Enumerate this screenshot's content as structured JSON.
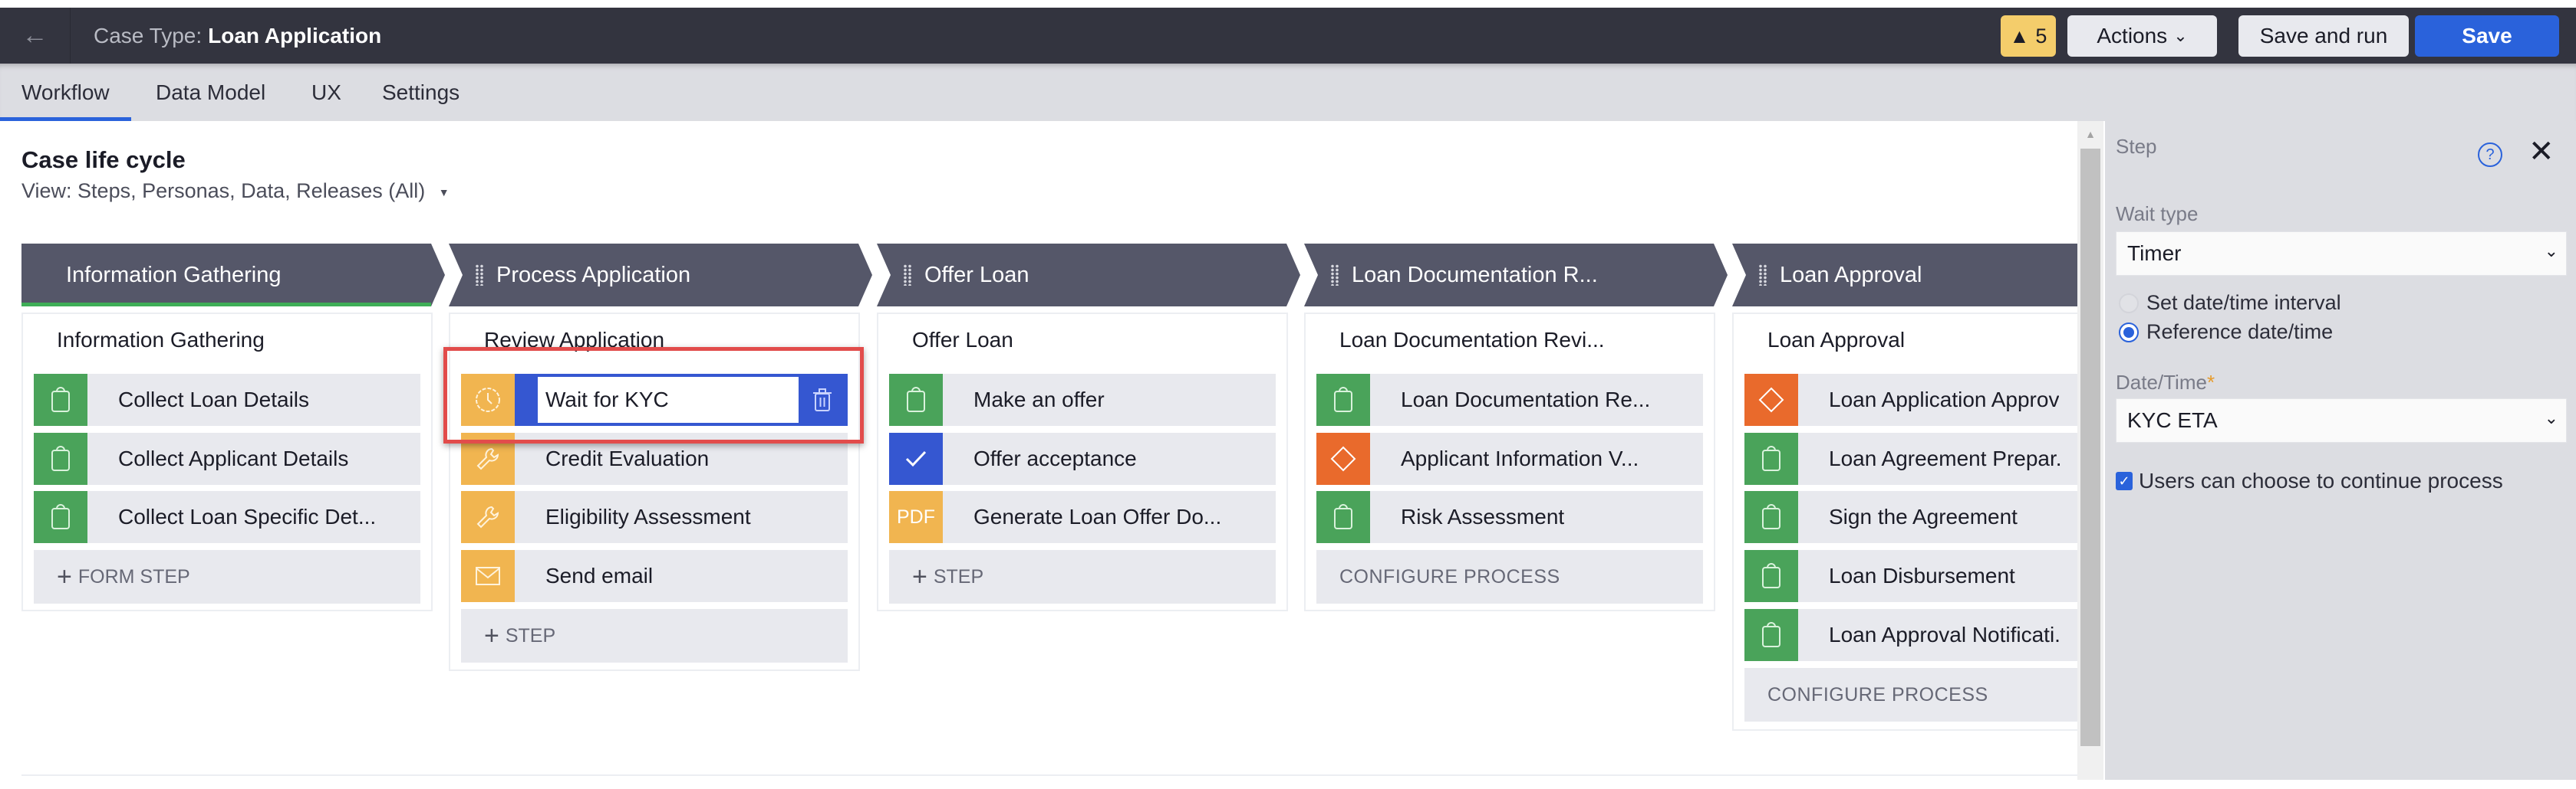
{
  "header": {
    "back_icon": "arrow-left-icon",
    "case_type_label": "Case Type:",
    "case_type_value": "Loan Application",
    "warning_count": "5",
    "warning_icon": "warning-triangle-icon",
    "actions_label": "Actions",
    "save_and_run_label": "Save and run",
    "save_label": "Save"
  },
  "tabs": [
    {
      "label": "Workflow",
      "active": true
    },
    {
      "label": "Data Model",
      "active": false
    },
    {
      "label": "UX",
      "active": false
    },
    {
      "label": "Settings",
      "active": false
    }
  ],
  "lifecycle": {
    "title": "Case life cycle",
    "view_label": "View: Steps, Personas, Data, Releases (All)"
  },
  "stages": [
    {
      "name": "Information Gathering",
      "completed_indicator": true,
      "process": "Information Gathering",
      "steps": [
        {
          "label": "Collect Loan Details",
          "icon": "form-clipboard-icon",
          "color": "#4aa35a"
        },
        {
          "label": "Collect Applicant Details",
          "icon": "form-clipboard-icon",
          "color": "#4aa35a"
        },
        {
          "label": "Collect Loan Specific Det...",
          "icon": "form-clipboard-icon",
          "color": "#4aa35a"
        }
      ],
      "add_label": "FORM STEP"
    },
    {
      "name": "Process Application",
      "process": "Review Application",
      "steps": [
        {
          "label": "Wait for KYC",
          "icon": "clock-icon",
          "color": "#f1b550",
          "selected": true
        },
        {
          "label": "Credit Evaluation",
          "icon": "wrench-icon",
          "color": "#f1b550"
        },
        {
          "label": "Eligibility Assessment",
          "icon": "wrench-icon",
          "color": "#f1b550"
        },
        {
          "label": "Send email",
          "icon": "envelope-icon",
          "color": "#f1b550"
        }
      ],
      "add_label": "STEP"
    },
    {
      "name": "Offer Loan",
      "process": "Offer Loan",
      "steps": [
        {
          "label": "Make an offer",
          "icon": "form-clipboard-icon",
          "color": "#4aa35a"
        },
        {
          "label": "Offer acceptance",
          "icon": "checkmark-icon",
          "color": "#3557d1"
        },
        {
          "label": "Generate Loan Offer Do...",
          "icon": "pdf-icon",
          "icon_text": "PDF",
          "color": "#f1b550"
        }
      ],
      "add_label": "STEP"
    },
    {
      "name": "Loan Documentation R...",
      "process": "Loan Documentation Revi...",
      "steps": [
        {
          "label": "Loan Documentation Re...",
          "icon": "form-clipboard-icon",
          "color": "#4aa35a"
        },
        {
          "label": "Applicant Information V...",
          "icon": "decision-diamond-icon",
          "color": "#e96a2c"
        },
        {
          "label": "Risk Assessment",
          "icon": "form-clipboard-icon",
          "color": "#4aa35a"
        }
      ],
      "add_label": "CONFIGURE PROCESS"
    },
    {
      "name": "Loan Approval",
      "process": "Loan Approval",
      "steps": [
        {
          "label": "Loan Application Approv",
          "icon": "decision-diamond-icon",
          "color": "#e96a2c"
        },
        {
          "label": "Loan Agreement Prepar.",
          "icon": "form-clipboard-icon",
          "color": "#4aa35a"
        },
        {
          "label": "Sign the Agreement",
          "icon": "form-clipboard-icon",
          "color": "#4aa35a"
        },
        {
          "label": "Loan Disbursement",
          "icon": "form-clipboard-icon",
          "color": "#4aa35a"
        },
        {
          "label": "Loan Approval Notificati.",
          "icon": "form-clipboard-icon",
          "color": "#4aa35a"
        }
      ],
      "add_label": "CONFIGURE PROCESS"
    }
  ],
  "panel": {
    "title": "Step",
    "help_icon": "help-circle-icon",
    "close_icon": "close-icon",
    "wait_type_label": "Wait type",
    "wait_type_value": "Timer",
    "radio_options": [
      {
        "label": "Set date/time interval",
        "selected": false
      },
      {
        "label": "Reference date/time",
        "selected": true
      }
    ],
    "datetime_label": "Date/Time",
    "datetime_required_mark": "*",
    "datetime_value": "KYC ETA",
    "continue_checkbox_label": "Users can choose to continue process",
    "continue_checkbox_checked": true
  },
  "colors": {
    "accent": "#2a62db",
    "topbar": "#33343f",
    "stage_header": "#555769",
    "highlight": "#e24c4b",
    "form_step": "#4aa35a",
    "automation_step": "#f1b550",
    "decision_step": "#e96a2c",
    "approval_step": "#3557d1",
    "warning_badge": "#f4cd6b"
  }
}
